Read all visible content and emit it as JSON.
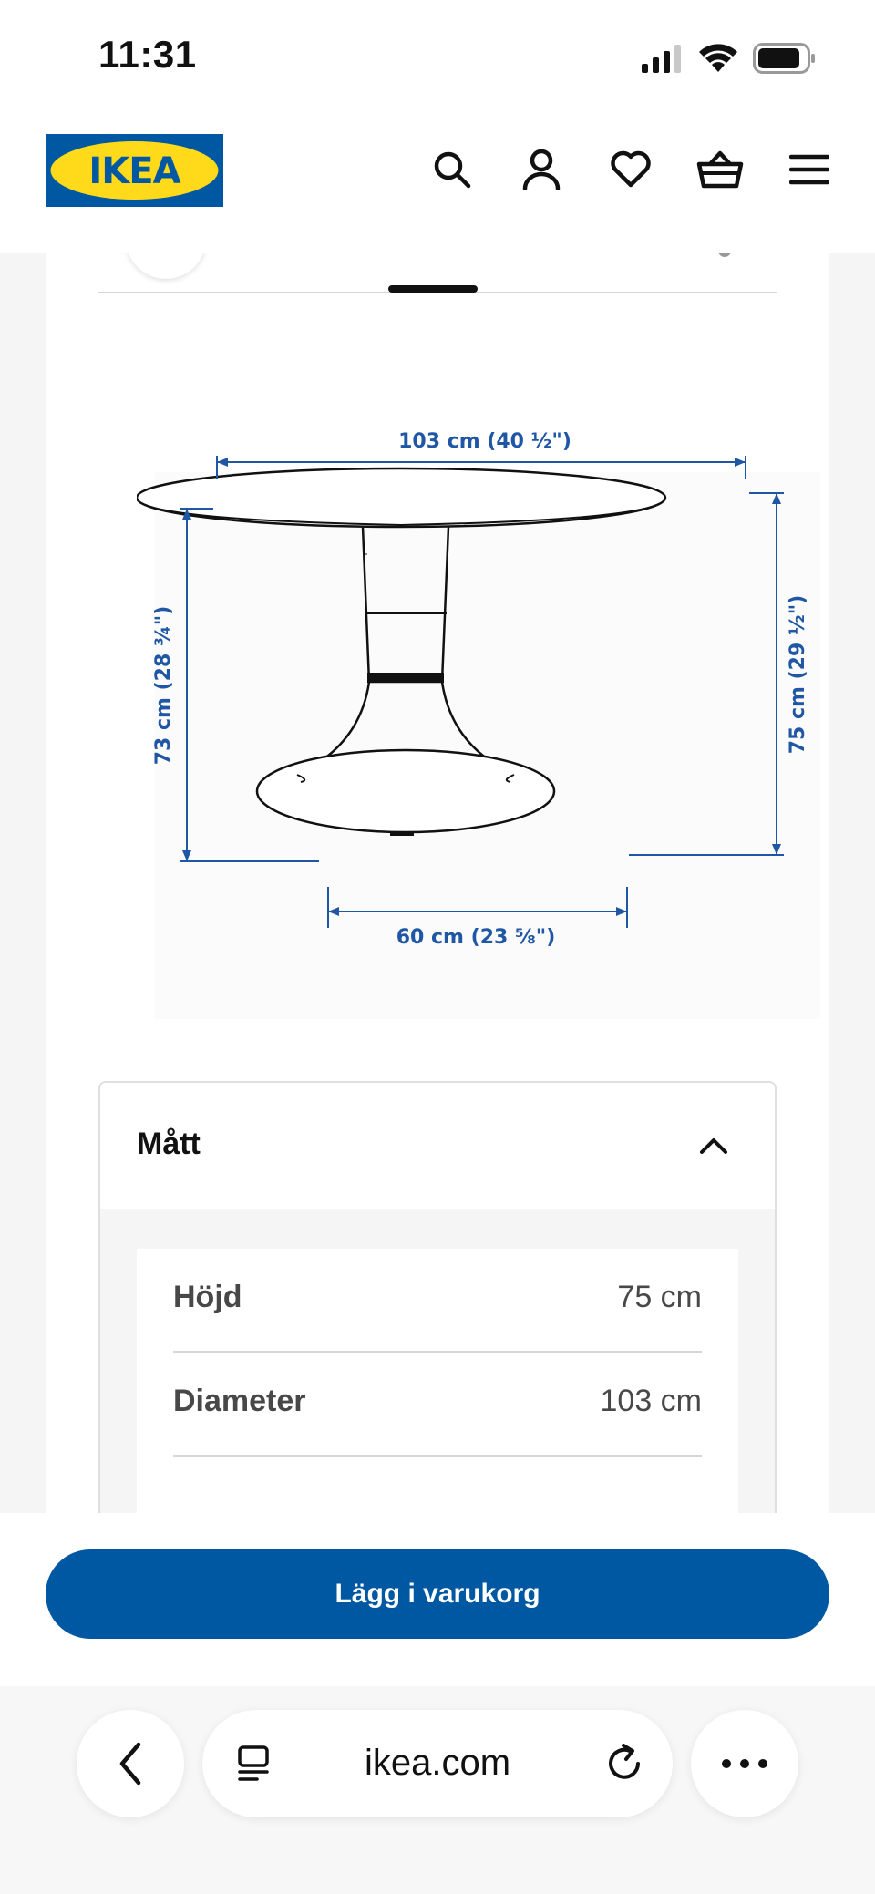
{
  "status_bar": {
    "time": "11:31"
  },
  "header": {
    "logo_text": "IKEA",
    "icons": [
      "search-icon",
      "account-icon",
      "heart-icon",
      "basket-icon",
      "menu-icon"
    ]
  },
  "diagram": {
    "top_width": "103 cm (40 ½\")",
    "left_height": "73 cm (28 ¾\")",
    "right_height": "75 cm (29 ½\")",
    "base_width": "60 cm (23 ⅝\")"
  },
  "dimensions": {
    "title": "Mått",
    "rows": [
      {
        "label": "Höjd",
        "value": "75 cm"
      },
      {
        "label": "Diameter",
        "value": "103 cm"
      }
    ]
  },
  "cta": {
    "add_to_cart": "Lägg i varukorg"
  },
  "browser": {
    "url": "ikea.com"
  },
  "colors": {
    "ikea_blue": "#0058a3",
    "ikea_yellow": "#ffda1a",
    "dimension_blue": "#1f57a5"
  }
}
